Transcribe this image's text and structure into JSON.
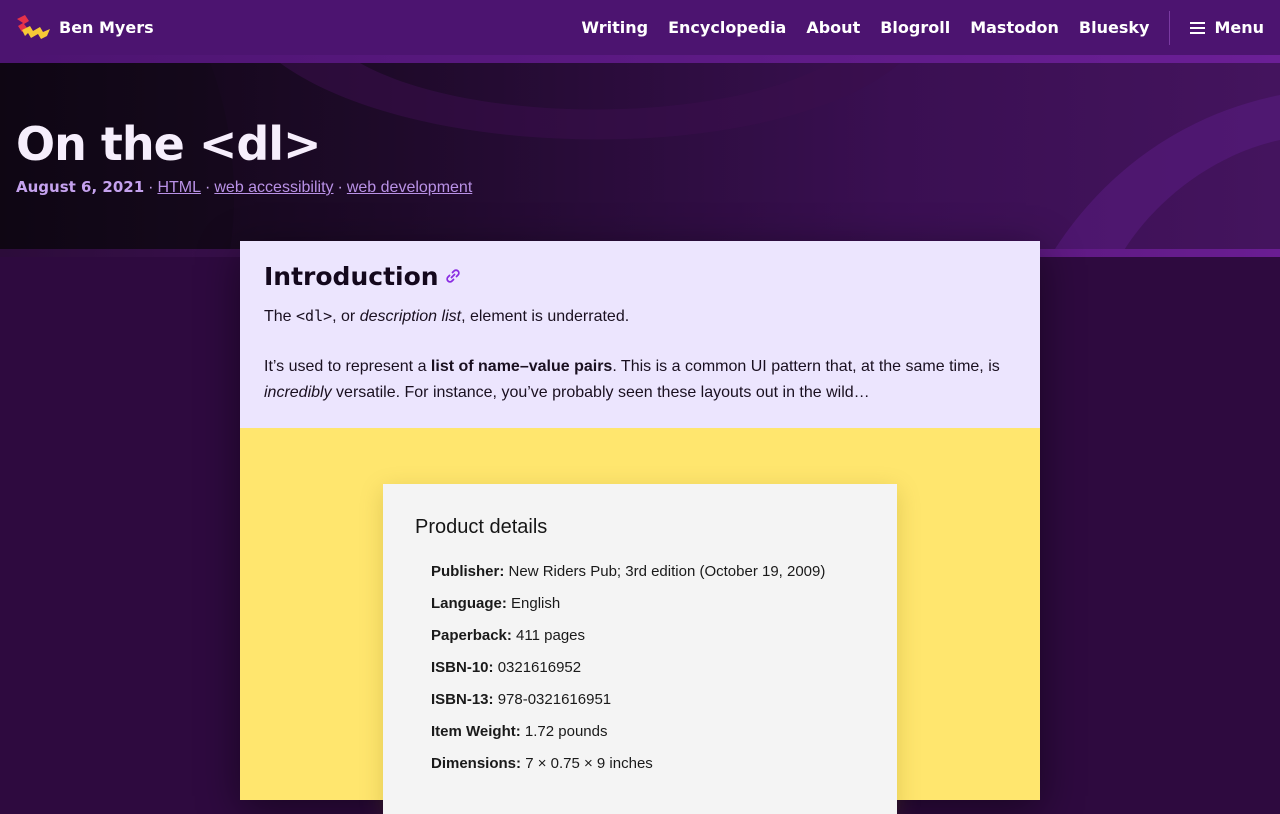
{
  "nav": {
    "brand": "Ben Myers",
    "links": [
      "Writing",
      "Encyclopedia",
      "About",
      "Blogroll",
      "Mastodon",
      "Bluesky"
    ],
    "menu_label": "Menu"
  },
  "post": {
    "title": "On the <dl>",
    "date": "August 6, 2021",
    "tags": [
      "HTML",
      "web accessibility",
      "web development"
    ]
  },
  "intro": {
    "heading": "Introduction",
    "p1": {
      "before": "The ",
      "code": "<dl>",
      "middle": ", or ",
      "em": "description list",
      "after": ", element is underrated."
    },
    "p2": {
      "before": "It’s used to represent a ",
      "strong": "list of name–value pairs",
      "middle": ". This is a common UI pattern that, at the same time, is ",
      "em": "incredibly",
      "after": " versatile. For instance, you’ve probably seen these layouts out in the wild…"
    }
  },
  "product_details": {
    "title": "Product details",
    "items": [
      {
        "name": "Publisher:",
        "value": "New Riders Pub; 3rd edition (October 19, 2009)"
      },
      {
        "name": "Language:",
        "value": "English"
      },
      {
        "name": "Paperback:",
        "value": "411 pages"
      },
      {
        "name": "ISBN-10:",
        "value": "0321616952"
      },
      {
        "name": "ISBN-13:",
        "value": "978-0321616951"
      },
      {
        "name": "Item Weight:",
        "value": "1.72 pounds"
      },
      {
        "name": "Dimensions:",
        "value": "7 × 0.75 × 9 inches"
      }
    ]
  },
  "colors": {
    "nav_bg": "#4c1470",
    "page_bg": "#2e0a3f",
    "intro_bg": "#ece5fe",
    "figure_bg": "#ffe66e",
    "card_bg": "#f4f4f4",
    "link_icon": "#8a2be2"
  },
  "icons": {
    "brand": "zigzag-logo-icon",
    "menu": "hamburger-icon",
    "heading_link": "link-chain-icon"
  }
}
